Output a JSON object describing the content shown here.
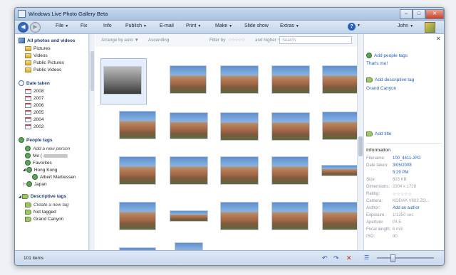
{
  "window": {
    "title": "Windows Live Photo Gallery Beta",
    "controls": [
      "–",
      "□",
      "✕"
    ]
  },
  "menu": {
    "items": [
      {
        "label": "File",
        "dropdown": true
      },
      {
        "label": "Fix",
        "dropdown": false
      },
      {
        "label": "Info",
        "dropdown": false
      },
      {
        "label": "Publish",
        "dropdown": true
      },
      {
        "label": "E-mail",
        "dropdown": false
      },
      {
        "label": "Print",
        "dropdown": true
      },
      {
        "label": "Make",
        "dropdown": true
      },
      {
        "label": "Slide show",
        "dropdown": false
      },
      {
        "label": "Extras",
        "dropdown": true
      }
    ],
    "user": "John",
    "caret": "▼",
    "help": "?"
  },
  "sidebar": {
    "all_photos": "All photos and videos",
    "all_items": [
      "Pictures",
      "Videos",
      "Public Pictures",
      "Public Videos"
    ],
    "date_taken": "Date taken",
    "years": [
      "2008",
      "2007",
      "2006",
      "2005",
      "2004",
      "2002"
    ],
    "people_tags": "People tags",
    "people_items": {
      "add": "Add a new person",
      "me": "Me (",
      "favorites": "Favorites",
      "hong_kong": "Hong Kong",
      "albert": "Albert Martiessen",
      "japan": "Japan"
    },
    "descriptive_tags": "Descriptive tags",
    "desc_items": {
      "create": "Create a new tag",
      "not_tagged": "Not tagged",
      "grand_canyon": "Grand Canyon"
    }
  },
  "filterbar": {
    "arrange": "Arrange by auto",
    "ascending": "Ascending",
    "filter_by": "Filter by",
    "stars": "☆☆☆☆☆",
    "higher": "and higher",
    "search_placeholder": "Search"
  },
  "infopane": {
    "add_people_tags": "Add people tags",
    "thats_me": "That's me!",
    "add_descriptive_tag": "Add descriptive tag",
    "grand_canyon": "Grand Canyon",
    "add_title": "Add title",
    "information": "Information",
    "meta": [
      {
        "k": "Filename:",
        "v": "100_4411.JPG"
      },
      {
        "k": "Date taken:",
        "v": "3/05/2008"
      },
      {
        "k": "",
        "v": "5:29 PM"
      },
      {
        "k": "Size:",
        "v": "823 KB",
        "gray": true
      },
      {
        "k": "Dimensions:",
        "v": "2304 x 1728",
        "gray": true
      },
      {
        "k": "Rating:",
        "v": "☆☆☆☆☆",
        "gray": true
      },
      {
        "k": "Camera:",
        "v": "KODAK V603 ZO...",
        "gray": true
      },
      {
        "k": "Author:",
        "v": "Add an author"
      },
      {
        "k": "Exposure:",
        "v": "1/1250 sec",
        "gray": true
      },
      {
        "k": "Aperture:",
        "v": "f/4.5",
        "gray": true
      },
      {
        "k": "Focal length:",
        "v": "6 mm",
        "gray": true
      },
      {
        "k": "ISO:",
        "v": "80",
        "gray": true
      }
    ]
  },
  "status": {
    "count": "101 items"
  }
}
